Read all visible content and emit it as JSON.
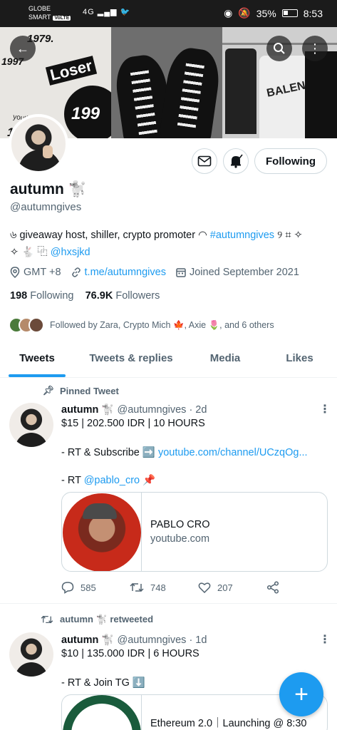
{
  "status_bar": {
    "carrier_line1": "GLOBE",
    "carrier_line2": "SMART",
    "volte": "VoLTE",
    "network_left": "4G",
    "battery": "35%",
    "time": "8:53"
  },
  "banner": {
    "text_1979": "1979.",
    "text_1997": "1997",
    "text_loser": "Loser",
    "text_circle": "199",
    "text_youth_loser": "youth loser",
    "text_199": "199",
    "text_balenciaga": "BALENC"
  },
  "profile": {
    "name": "autumn 🐩",
    "handle": "@autumngives",
    "bio_line1_prefix": "৬ giveaway host, shiller, crypto promoter ◠ ",
    "bio_hashtag": "#autumngives",
    "bio_line1_suffix": " ୨ ⌗ ✧",
    "bio_line2_prefix": "✧ 🐇 ⿻ ",
    "bio_mention": "@hxsjkd",
    "location": "GMT +8",
    "website": "t.me/autumngives",
    "joined": "Joined September 2021",
    "following_count": "198",
    "following_label": "Following",
    "followers_count": "76.9K",
    "followers_label": "Followers",
    "followed_by": "Followed by Zara, Crypto Mich 🍁, Axie 🌷, and 6 others",
    "follow_button": "Following"
  },
  "tabs": [
    {
      "label": "Tweets"
    },
    {
      "label": "Tweets & replies"
    },
    {
      "label": "Media"
    },
    {
      "label": "Likes"
    }
  ],
  "tweets": [
    {
      "context": "Pinned Tweet",
      "author": "autumn 🐩",
      "handle": "@autumngives",
      "time": "· 2d",
      "line1": "$15 | 202.500 IDR | 10 HOURS",
      "line2_prefix": "- RT & Subscribe ➡️ ",
      "line2_link": "youtube.com/channel/UCzqOg...",
      "line3_prefix": "- RT ",
      "line3_mention": "@pablo_cro",
      "line3_suffix": " 📌",
      "card_title": "PABLO CRO",
      "card_subtitle": "youtube.com",
      "replies": "585",
      "retweets": "748",
      "likes": "207"
    },
    {
      "context": "autumn 🐩 retweeted",
      "author": "autumn 🐩",
      "handle": "@autumngives",
      "time": "· 1d",
      "line1": "$10 | 135.000 IDR | 6 HOURS",
      "line2": "- RT & Join TG ⬇️",
      "card_title": "Ethereum 2.0｜Launching @ 8:30"
    }
  ]
}
